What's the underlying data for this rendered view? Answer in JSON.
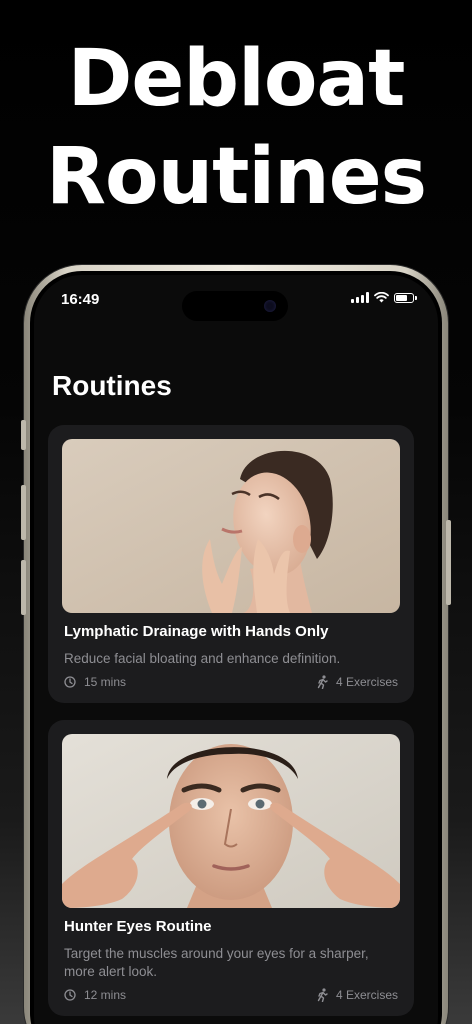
{
  "promo": {
    "title_line1": "Debloat",
    "title_line2": "Routines"
  },
  "status_bar": {
    "time": "16:49",
    "icons": [
      "signal-icon",
      "wifi-icon",
      "battery-icon"
    ]
  },
  "page": {
    "title": "Routines"
  },
  "routines": [
    {
      "title": "Lymphatic Drainage with Hands Only",
      "description": "Reduce facial bloating and enhance definition.",
      "duration": "15 mins",
      "exercises": "4 Exercises",
      "image": "woman-face-massage-photo"
    },
    {
      "title": "Hunter Eyes Routine",
      "description": "Target the muscles around your eyes for a sharper, more alert look.",
      "duration": "12 mins",
      "exercises": "4 Exercises",
      "image": "man-eye-massage-photo"
    }
  ],
  "colors": {
    "background": "#000000",
    "card": "#1c1c1e",
    "text_primary": "#ffffff",
    "text_secondary": "#8e8e93",
    "phone_frame": "#e8e4da"
  }
}
